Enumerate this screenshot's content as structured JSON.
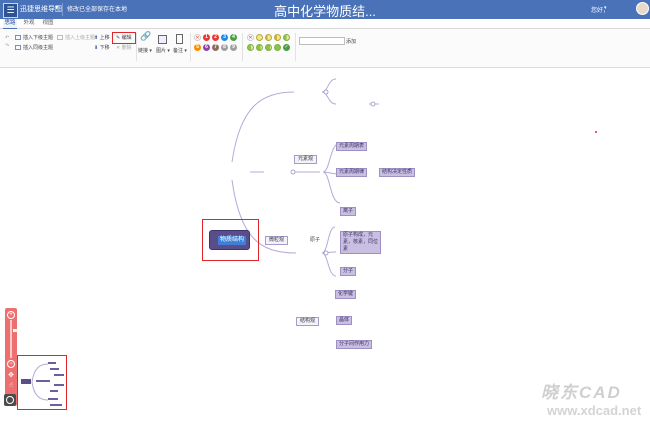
{
  "titlebar": {
    "app_name": "迅捷思维导图",
    "save_status": "修改已全部保存在本地",
    "document_title": "高中化学物质结...",
    "greeting": "您好，"
  },
  "tabs": [
    {
      "label": "思路",
      "active": true
    },
    {
      "label": "外观",
      "active": false
    },
    {
      "label": "视图",
      "active": false
    }
  ],
  "toolbar": {
    "insert_child": "插入下级主题",
    "insert_parent": "插入上级主题",
    "insert_sibling": "插入同级主题",
    "move_up": "上移",
    "move_down": "下移",
    "edit": "编辑",
    "delete": "删除",
    "link": "链接",
    "image": "图片",
    "note": "备注",
    "add": "添加",
    "priority_colors": [
      "#e53935",
      "#e53935",
      "#1e88e5",
      "#43a047",
      "#fb8c00",
      "#8e44ad",
      "#8d6e63",
      "#9e9e9e",
      "#9e9e9e",
      "#9e9e9e"
    ],
    "priority_labels": [
      "1",
      "2",
      "3",
      "4",
      "5",
      "6",
      "7",
      "8",
      "9"
    ]
  },
  "mindmap": {
    "root": "物质结构",
    "branches": {
      "b1": {
        "label": "元素观",
        "c1": "元素周期表",
        "c2": "元素周期律",
        "c2a": "结构决定性质"
      },
      "b2": {
        "label": "微粒观",
        "sub": "原子",
        "c1": "离子",
        "c2": "原子构成，元素，核素，同位素",
        "c3": "分子"
      },
      "b3": {
        "label": "结构观",
        "c1": "化学键",
        "c2": "晶体",
        "c3": "分子间作用力"
      }
    }
  },
  "zoom": {
    "zoom_in": "+",
    "zoom_out": "−",
    "level_fraction": 0.75
  },
  "watermark": {
    "brand": "晓东CAD",
    "url": "www.xdcad.net"
  }
}
